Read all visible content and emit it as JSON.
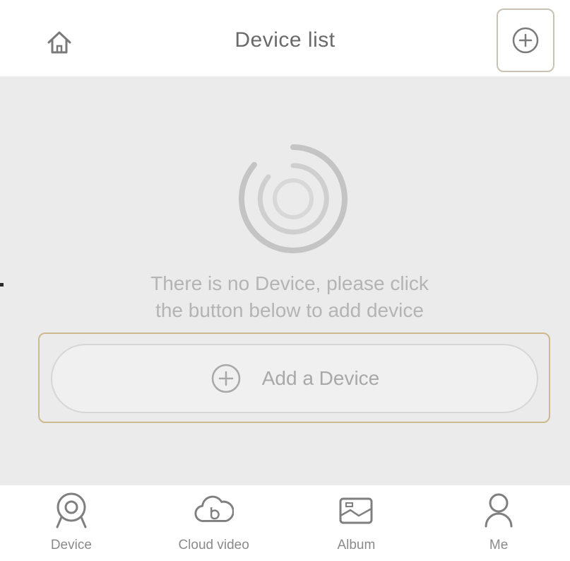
{
  "header": {
    "title": "Device list",
    "home_icon": "home-icon",
    "add_icon": "plus-circle-icon"
  },
  "empty_state": {
    "icon": "device-ring-icon",
    "message_line1": "There is no Device, please click",
    "message_line2": "the button below to add device"
  },
  "add_device": {
    "label": "Add a Device",
    "icon": "plus-circle-icon"
  },
  "tabs": [
    {
      "label": "Device",
      "icon": "camera-icon"
    },
    {
      "label": "Cloud video",
      "icon": "cloud-video-icon"
    },
    {
      "label": "Album",
      "icon": "album-icon"
    },
    {
      "label": "Me",
      "icon": "person-icon"
    }
  ],
  "colors": {
    "background": "#ebebeb",
    "highlight_border": "#cdb98f",
    "icon": "#8a8a8a"
  }
}
